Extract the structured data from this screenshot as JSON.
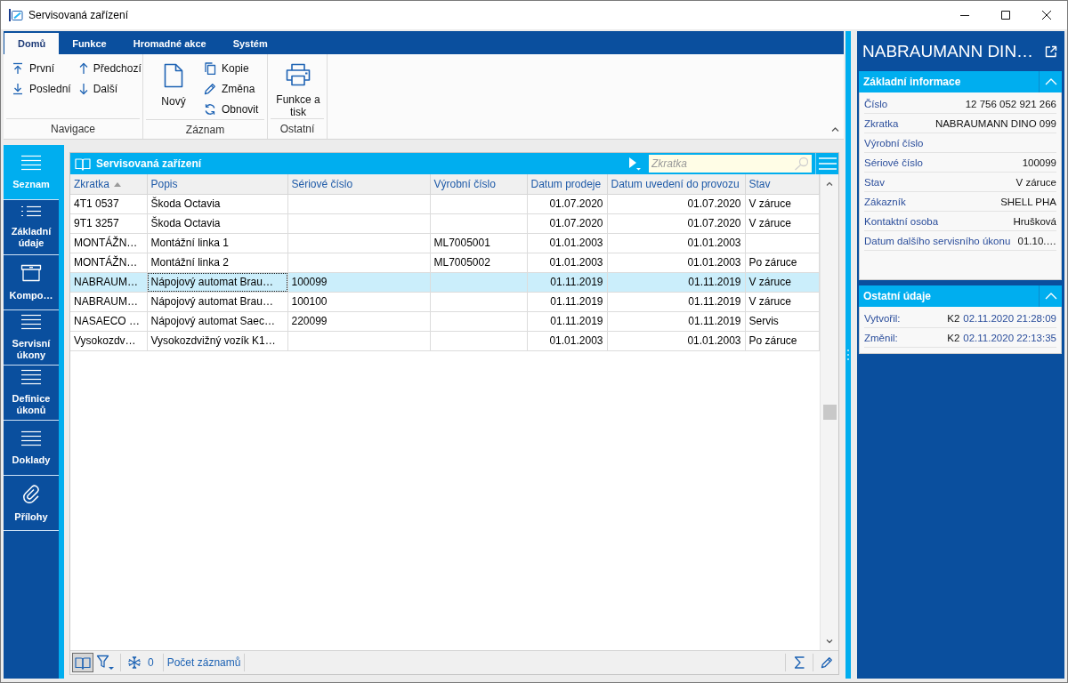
{
  "window": {
    "title": "Servisovaná zařízení"
  },
  "ribbon": {
    "tabs": [
      {
        "label": "Domů",
        "selected": true
      },
      {
        "label": "Funkce",
        "selected": false
      },
      {
        "label": "Hromadné akce",
        "selected": false
      },
      {
        "label": "Systém",
        "selected": false
      }
    ],
    "groups": [
      {
        "label": "Navigace",
        "columns": [
          [
            {
              "label": "První",
              "kind": "small"
            },
            {
              "label": "Poslední",
              "kind": "small"
            }
          ],
          [
            {
              "label": "Předchozí",
              "kind": "small"
            },
            {
              "label": "Další",
              "kind": "small"
            }
          ]
        ]
      },
      {
        "label": "Záznam",
        "columns": [
          [
            {
              "label": "Nový",
              "kind": "large"
            }
          ],
          [
            {
              "label": "Kopie",
              "kind": "small"
            },
            {
              "label": "Změna",
              "kind": "small"
            },
            {
              "label": "Obnovit",
              "kind": "small"
            }
          ]
        ]
      },
      {
        "label": "Ostatní",
        "columns": [
          [
            {
              "label": "Funkce a tisk",
              "kind": "large"
            }
          ]
        ]
      }
    ]
  },
  "sidebar": {
    "items": [
      {
        "label": "Seznam",
        "selected": true
      },
      {
        "label": "Základní údaje",
        "selected": false
      },
      {
        "label": "Kompo…",
        "selected": false
      },
      {
        "label": "Servisní úkony",
        "selected": false
      },
      {
        "label": "Definice úkonů",
        "selected": false
      },
      {
        "label": "Doklady",
        "selected": false
      },
      {
        "label": "Přílohy",
        "selected": false
      }
    ]
  },
  "table": {
    "title": "Servisovaná zařízení",
    "search": {
      "placeholder": "Zkratka"
    },
    "columns": [
      {
        "label": "Zkratka",
        "kind": "text",
        "sorted": true
      },
      {
        "label": "Popis",
        "kind": "text",
        "sorted": false
      },
      {
        "label": "Sériové číslo",
        "kind": "text",
        "sorted": false
      },
      {
        "label": "Výrobní číslo",
        "kind": "text",
        "sorted": false
      },
      {
        "label": "Datum prodeje",
        "kind": "date",
        "sorted": false
      },
      {
        "label": "Datum uvedení do provozu",
        "kind": "date",
        "sorted": false
      },
      {
        "label": "Stav",
        "kind": "text",
        "sorted": false
      }
    ],
    "rows": [
      {
        "selected": false,
        "cells": [
          {
            "text": "4T1 0537",
            "focused": false
          },
          {
            "text": "Škoda Octavia",
            "focused": false
          },
          {
            "focused": false
          },
          {
            "focused": false
          },
          {
            "text": "01.07.2020",
            "focused": false
          },
          {
            "text": "01.07.2020",
            "focused": false
          },
          {
            "text": "V záruce",
            "focused": false
          }
        ]
      },
      {
        "selected": false,
        "cells": [
          {
            "text": "9T1 3257",
            "focused": false
          },
          {
            "text": "Škoda Octavia",
            "focused": false
          },
          {
            "focused": false
          },
          {
            "focused": false
          },
          {
            "text": "01.07.2020",
            "focused": false
          },
          {
            "text": "01.07.2020",
            "focused": false
          },
          {
            "text": "V záruce",
            "focused": false
          }
        ]
      },
      {
        "selected": false,
        "cells": [
          {
            "text": "MONTÁŽN…",
            "focused": false
          },
          {
            "text": "Montážní linka 1",
            "focused": false
          },
          {
            "focused": false
          },
          {
            "text": "ML7005001",
            "focused": false
          },
          {
            "text": "01.01.2003",
            "focused": false
          },
          {
            "text": "01.01.2003",
            "focused": false
          },
          {
            "focused": false
          }
        ]
      },
      {
        "selected": false,
        "cells": [
          {
            "text": "MONTÁŽN…",
            "focused": false
          },
          {
            "text": "Montážní linka 2",
            "focused": false
          },
          {
            "focused": false
          },
          {
            "text": "ML7005002",
            "focused": false
          },
          {
            "text": "01.01.2003",
            "focused": false
          },
          {
            "text": "01.01.2003",
            "focused": false
          },
          {
            "text": "Po záruce",
            "focused": false
          }
        ]
      },
      {
        "selected": true,
        "cells": [
          {
            "text": "NABRAUM…",
            "focused": false
          },
          {
            "text": "Nápojový automat Brau…",
            "focused": true
          },
          {
            "text": "100099",
            "focused": false
          },
          {
            "focused": false
          },
          {
            "text": "01.11.2019",
            "focused": false
          },
          {
            "text": "01.11.2019",
            "focused": false
          },
          {
            "text": "V záruce",
            "focused": false
          }
        ]
      },
      {
        "selected": false,
        "cells": [
          {
            "text": "NABRAUM…",
            "focused": false
          },
          {
            "text": "Nápojový automat Brau…",
            "focused": false
          },
          {
            "text": "100100",
            "focused": false
          },
          {
            "focused": false
          },
          {
            "text": "01.11.2019",
            "focused": false
          },
          {
            "text": "01.11.2019",
            "focused": false
          },
          {
            "text": "V záruce",
            "focused": false
          }
        ]
      },
      {
        "selected": false,
        "cells": [
          {
            "text": "NASAECO …",
            "focused": false
          },
          {
            "text": "Nápojový automat Saec…",
            "focused": false
          },
          {
            "text": "220099",
            "focused": false
          },
          {
            "focused": false
          },
          {
            "text": "01.11.2019",
            "focused": false
          },
          {
            "text": "01.11.2019",
            "focused": false
          },
          {
            "text": "Servis",
            "focused": false
          }
        ]
      },
      {
        "selected": false,
        "cells": [
          {
            "text": "Vysokozdv…",
            "focused": false
          },
          {
            "text": "Vysokozdvižný vozík K1…",
            "focused": false
          },
          {
            "focused": false
          },
          {
            "focused": false
          },
          {
            "text": "01.01.2003",
            "focused": false
          },
          {
            "text": "01.01.2003",
            "focused": false
          },
          {
            "text": "Po záruce",
            "focused": false
          }
        ]
      }
    ]
  },
  "status_bar": {
    "view_toggle": {
      "on": true
    },
    "count": "0",
    "count_label": "Počet záznamů"
  },
  "detail": {
    "title": "NABRAUMANN DIN…",
    "sections": [
      {
        "title": "Základní informace",
        "expanded": true,
        "rows": [
          {
            "label": "Číslo",
            "value": "12 756 052 921 266"
          },
          {
            "label": "Zkratka",
            "value": "NABRAUMANN DINO 099"
          },
          {
            "label": "Výrobní číslo"
          },
          {
            "label": "Sériové číslo",
            "value": "100099"
          },
          {
            "label": "Stav",
            "value": "V záruce"
          },
          {
            "label": "Zákazník",
            "value": "SHELL PHA"
          },
          {
            "label": "Kontaktní osoba",
            "value": "Hrušková"
          },
          {
            "label": "Datum dalšího servisního úkonu",
            "value": "01.10.…"
          }
        ]
      },
      {
        "title": "Ostatní údaje",
        "expanded": true,
        "rows": [
          {
            "label": "Vytvořil:",
            "user": "K2",
            "value": "02.11.2020 21:28:09"
          },
          {
            "label": "Změnil:",
            "user": "K2",
            "value": "02.11.2020 22:13:35"
          }
        ]
      }
    ]
  }
}
